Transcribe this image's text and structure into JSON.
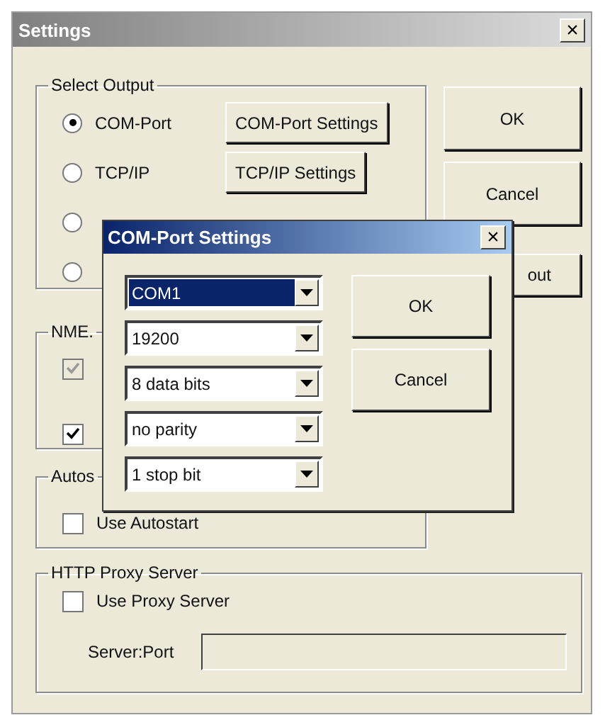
{
  "window": {
    "title": "Settings",
    "close": "×"
  },
  "select_output": {
    "label": "Select Output",
    "options": [
      {
        "label": "COM-Port",
        "selected": true,
        "button": "COM-Port Settings"
      },
      {
        "label": "TCP/IP",
        "selected": false,
        "button": "TCP/IP Settings"
      },
      {
        "selected": false
      },
      {
        "selected": false
      }
    ]
  },
  "buttons": [
    "OK",
    "Cancel",
    "out"
  ],
  "nmea": {
    "label": "NME.",
    "checkboxes": [
      {
        "checked": true,
        "disabled": true
      },
      {
        "checked": true,
        "disabled": false
      }
    ]
  },
  "autostart": {
    "label": "Autos",
    "checkbox": {
      "label": "Use Autostart",
      "checked": false
    }
  },
  "proxy": {
    "label": "HTTP Proxy Server",
    "checkbox": {
      "label": "Use Proxy Server",
      "checked": false
    },
    "server_port": {
      "label": "Server:Port"
    }
  },
  "dialog": {
    "title": "COM-Port Settings",
    "close": "×",
    "combos": [
      {
        "value": "COM1",
        "selected": true
      },
      {
        "value": "19200",
        "selected": false
      },
      {
        "value": "8 data bits",
        "selected": false
      },
      {
        "value": "no parity",
        "selected": false
      },
      {
        "value": "1 stop bit",
        "selected": false
      }
    ],
    "buttons": [
      "OK",
      "Cancel"
    ]
  }
}
